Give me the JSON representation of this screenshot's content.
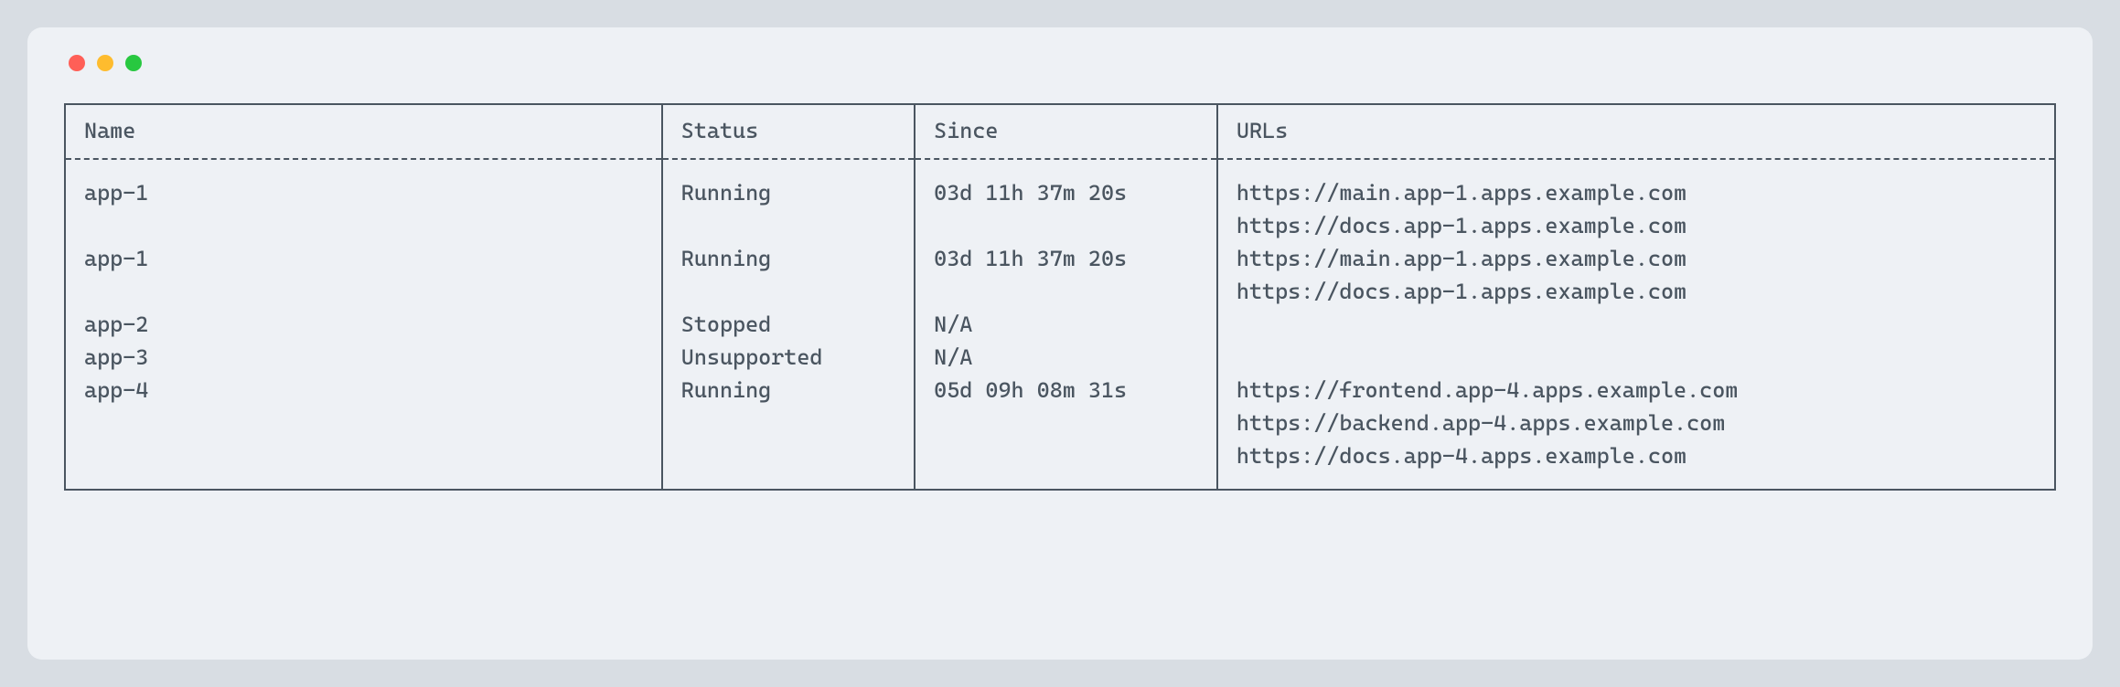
{
  "table": {
    "headers": {
      "name": "Name",
      "status": "Status",
      "since": "Since",
      "urls": "URLs"
    },
    "rows": [
      {
        "name": "app-1",
        "status": "Running",
        "since": "03d 11h 37m 20s",
        "urls": [
          "https://main.app-1.apps.example.com",
          "https://docs.app-1.apps.example.com"
        ]
      },
      {
        "name": "app-1",
        "status": "Running",
        "since": "03d 11h 37m 20s",
        "urls": [
          "https://main.app-1.apps.example.com",
          "https://docs.app-1.apps.example.com"
        ]
      },
      {
        "name": "app-2",
        "status": "Stopped",
        "since": "N/A",
        "urls": []
      },
      {
        "name": "app-3",
        "status": "Unsupported",
        "since": "N/A",
        "urls": []
      },
      {
        "name": "app-4",
        "status": "Running",
        "since": "05d 09h 08m 31s",
        "urls": [
          "https://frontend.app-4.apps.example.com",
          "https://backend.app-4.apps.example.com",
          "https://docs.app-4.apps.example.com"
        ]
      }
    ]
  }
}
